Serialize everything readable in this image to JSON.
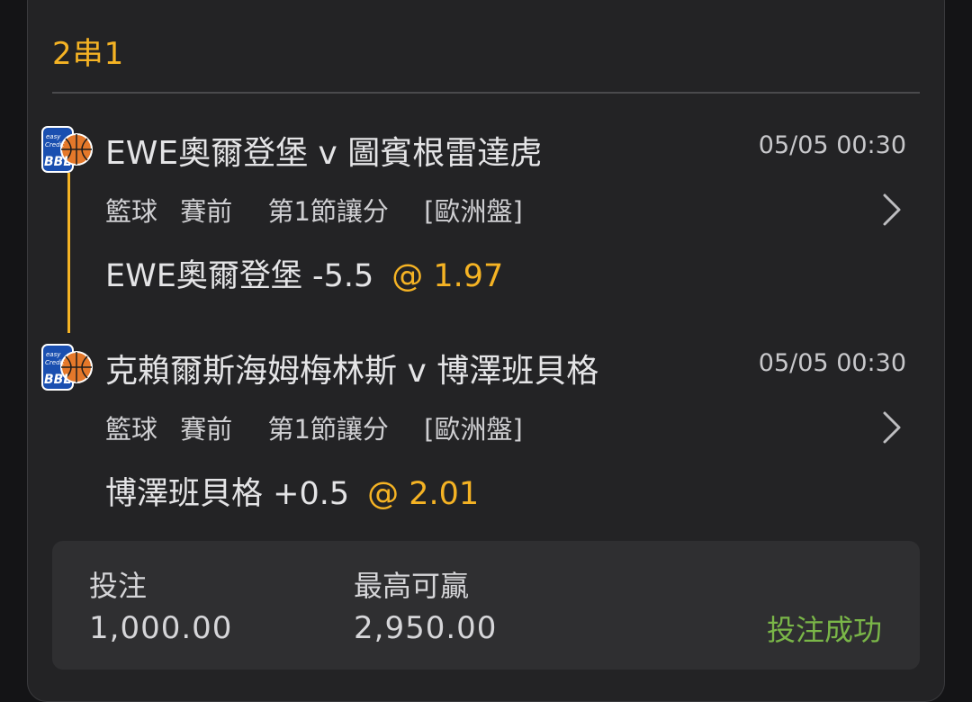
{
  "bet_type": "2串1",
  "legs": [
    {
      "league_logo_text": "BBL",
      "league_logo_subtext": "easyCredit",
      "match": "EWE奧爾登堡 v 圖賓根雷達虎",
      "time": "05/05 00:30",
      "sport": "籃球",
      "phase": "賽前",
      "market": "第1節讓分",
      "odds_format": "[歐洲盤]",
      "selection": "EWE奧爾登堡 -5.5",
      "odds": "@ 1.97"
    },
    {
      "league_logo_text": "BBL",
      "league_logo_subtext": "easyCredit",
      "match": "克賴爾斯海姆梅林斯 v 博澤班貝格",
      "time": "05/05 00:30",
      "sport": "籃球",
      "phase": "賽前",
      "market": "第1節讓分",
      "odds_format": "[歐洲盤]",
      "selection": "博澤班貝格 +0.5",
      "odds": "@ 2.01"
    }
  ],
  "footer": {
    "stake_label": "投注",
    "stake_value": "1,000.00",
    "max_win_label": "最高可贏",
    "max_win_value": "2,950.00",
    "status": "投注成功"
  },
  "colors": {
    "accent": "#f5b324",
    "success": "#7ab648",
    "background": "#232325"
  },
  "icons": {
    "league_logo": "bbl-logo-icon",
    "chevron": "chevron-right-icon"
  }
}
